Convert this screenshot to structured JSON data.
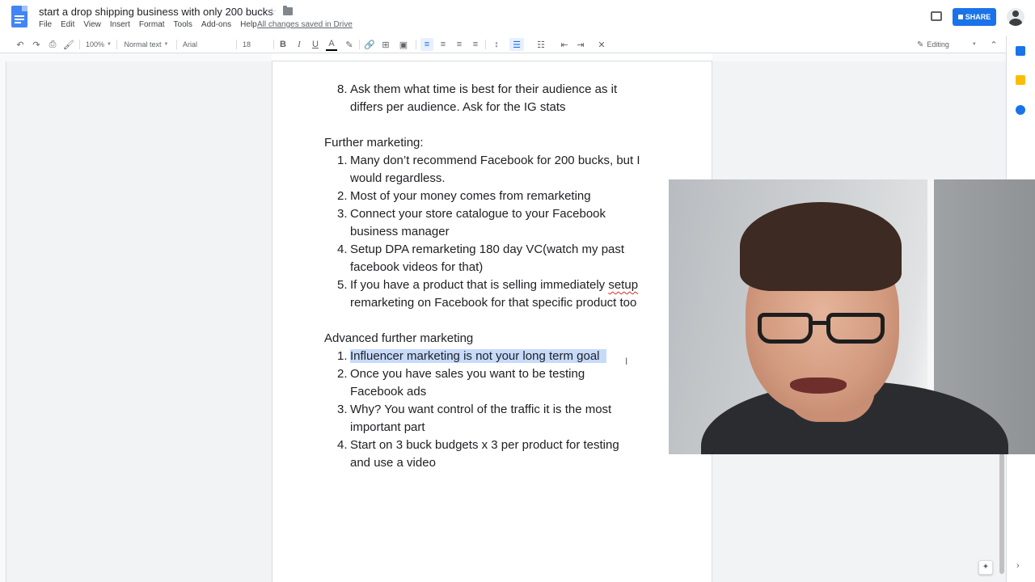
{
  "app": {
    "doc_title": "start a drop shipping business with only 200 bucks",
    "saved_status": "All changes saved in Drive",
    "menu": [
      "File",
      "Edit",
      "View",
      "Insert",
      "Format",
      "Tools",
      "Add-ons",
      "Help"
    ],
    "share_label": "SHARE"
  },
  "toolbar": {
    "zoom": "100%",
    "style": "Normal text",
    "font": "Arial",
    "size": "18",
    "mode": "Editing"
  },
  "document": {
    "item8_line1": "Ask them what time is best for their audience as it",
    "item8_line2": "differs per audience. Ask for the IG stats",
    "item8_num": "8.",
    "section1_heading": "Further marketing:",
    "section1": [
      {
        "num": "1.",
        "lines": [
          "Many don’t recommend Facebook for 200 bucks, but I",
          "would regardless."
        ]
      },
      {
        "num": "2.",
        "lines": [
          "Most of your money comes from remarketing"
        ]
      },
      {
        "num": "3.",
        "lines": [
          "Connect your store catalogue to your Facebook",
          "business manager"
        ]
      },
      {
        "num": "4.",
        "lines": [
          "Setup DPA remarketing 180 day VC(watch my past",
          "facebook videos for that)"
        ]
      },
      {
        "num": "5.",
        "lines_a": "If you have a product that is selling immediately ",
        "squiggle": "setup",
        "line2": "remarketing on Facebook for that specific product too"
      }
    ],
    "section2_heading": "Advanced further marketing",
    "section2": [
      {
        "num": "1.",
        "lines": [
          "Influencer marketing is not your long term goal"
        ]
      },
      {
        "num": "2.",
        "lines": [
          "Once you have sales you want to be testing",
          "Facebook ads"
        ]
      },
      {
        "num": "3.",
        "lines": [
          "Why? You want control of the traffic it is the most",
          "important part"
        ]
      },
      {
        "num": "4.",
        "lines": [
          "Start on 3 buck budgets x 3 per product for testing",
          "and use a video"
        ]
      }
    ]
  },
  "colors": {
    "accent": "#1a73e8",
    "selection": "#c6dafc",
    "spellcheck": "#d93025"
  }
}
